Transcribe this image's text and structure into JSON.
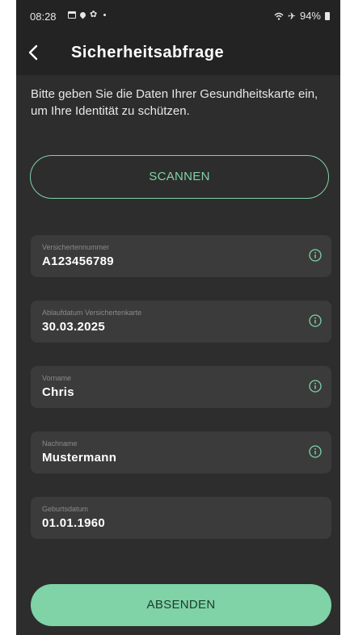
{
  "status_bar": {
    "time": "08:28",
    "battery": "94%"
  },
  "app_bar": {
    "title": "Sicherheitsabfrage"
  },
  "intro_text": "Bitte geben Sie die Daten Ihrer Gesundheitskarte ein, um Ihre Identität zu schützen.",
  "scan_button": {
    "label": "SCANNEN"
  },
  "fields": [
    {
      "label": "Versichertennummer",
      "value": "A123456789",
      "has_info": true
    },
    {
      "label": "Ablaufdatum Versichertenkarte",
      "value": "30.03.2025",
      "has_info": true
    },
    {
      "label": "Vorname",
      "value": "Chris",
      "has_info": true
    },
    {
      "label": "Nachname",
      "value": "Mustermann",
      "has_info": true
    },
    {
      "label": "Geburtsdatum",
      "value": "01.01.1960",
      "has_info": false
    }
  ],
  "submit_button": {
    "label": "ABSENDEN"
  },
  "colors": {
    "accent": "#7fd3a6",
    "background": "#2d2d2d",
    "field": "#3b3b3b",
    "app_bar": "#232323"
  },
  "icons": [
    "calendar-icon",
    "location-icon",
    "gear-icon",
    "wifi-icon",
    "airplane-icon",
    "battery-icon",
    "back-arrow-icon",
    "info-icon"
  ]
}
